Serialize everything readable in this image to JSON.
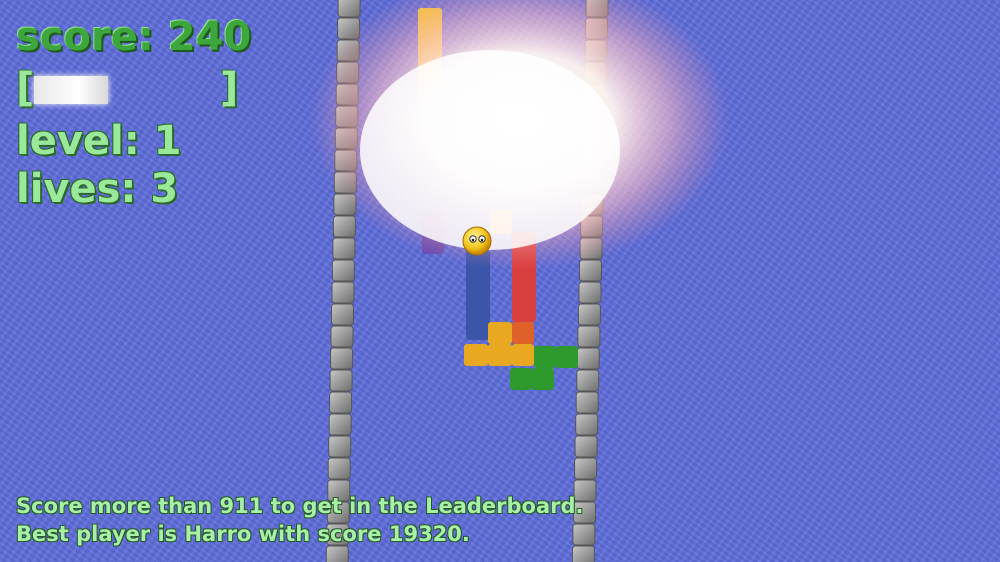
{
  "hud": {
    "score_text": "score: 240",
    "level_text": "level: 1",
    "lives_text": "lives: 3",
    "power_open": "[",
    "power_close": "]",
    "power_fraction": 0.4
  },
  "messages": {
    "leaderboard_hint": "Score more than 911 to get in the Leaderboard.",
    "best_player": "Best player is Harro with score 19320."
  },
  "colors": {
    "background": "#5f6edd",
    "hud_text": "#9ae89a",
    "wall_block": "#8a8a8a",
    "explosion": "#ffffff"
  },
  "icons": {
    "player": "smiley-ball-icon",
    "explosion": "explosion-flash-icon"
  }
}
